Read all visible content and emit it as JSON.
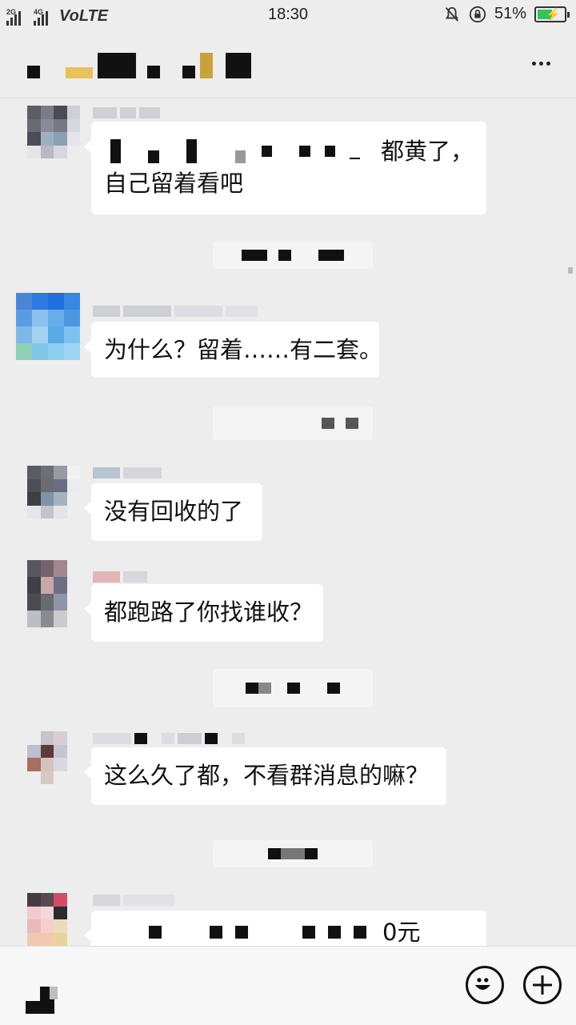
{
  "status_bar": {
    "network_1": "2G",
    "network_2": "4G",
    "volte": "VoLTE",
    "time": "18:30",
    "battery_percent": "51%",
    "battery_level": 0.51,
    "battery_color": "#35c35a"
  },
  "header": {
    "more_icon": "more-dots-icon"
  },
  "messages": [
    {
      "text_line1": "都黄了，",
      "text_line2": "自己留着看吧"
    },
    {
      "text": "为什么？留着……有二套。"
    },
    {
      "text": "没有回收的了"
    },
    {
      "text": "都跑路了你找谁收？"
    },
    {
      "text": "这么久了都，不看群消息的嘛？"
    },
    {
      "text_tail": "0元"
    }
  ],
  "input_bar": {
    "voice_icon": "voice-icon",
    "emoji_icon": "emoji-icon",
    "plus_icon": "plus-icon"
  },
  "colors": {
    "background": "#ededed",
    "bubble": "#ffffff",
    "text": "#111111"
  }
}
